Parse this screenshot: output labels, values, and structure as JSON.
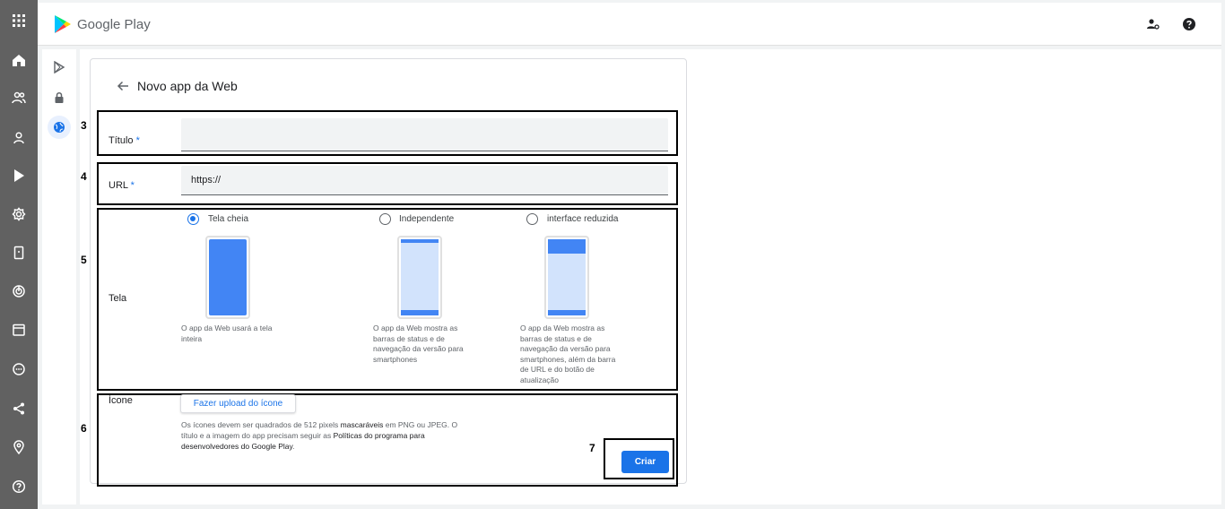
{
  "app": {
    "logo_text": "Google Play"
  },
  "left_nav": {
    "icons": [
      "apps-grid-icon",
      "home-icon",
      "users-icon",
      "user-icon",
      "play-icon",
      "settings-icon",
      "device-icon",
      "data-usage-icon",
      "calendar-icon",
      "chat-icon",
      "share-icon",
      "location-icon",
      "help-icon"
    ]
  },
  "sub_nav": {
    "icons": [
      "play-store-icon",
      "lock-icon",
      "web-globe-icon"
    ],
    "active": "web-globe-icon"
  },
  "header": {
    "title": "Novo app da Web"
  },
  "annotations": {
    "n3": "3",
    "n4": "4",
    "n5": "5",
    "n6": "6",
    "n7": "7"
  },
  "form": {
    "title_label": "Título",
    "url_label": "URL",
    "required_mark": "*",
    "title_value": "",
    "url_value": "https://",
    "display_label": "Tela",
    "display_options": [
      {
        "label": "Tela cheia",
        "checked": true,
        "description": "O app da Web usará a tela inteira"
      },
      {
        "label": "Independente",
        "checked": false,
        "description": "O app da Web mostra as barras de status e de navegação da versão para smartphones"
      },
      {
        "label": "interface reduzida",
        "checked": false,
        "description": "O app da Web mostra as barras de status e de navegação da versão para smartphones, além da barra de URL e do botão de atualização"
      }
    ],
    "icon_label": "Ícone",
    "upload_button": "Fazer upload do ícone",
    "icon_desc_1": "Os ícones devem ser quadrados de 512 pixels ",
    "icon_desc_2": "mascaráveis",
    "icon_desc_3": " em PNG ou JPEG. O título e a imagem do app precisam seguir as ",
    "icon_desc_4": "Políticas do programa para desenvolvedores do Google Play",
    "icon_desc_5": ".",
    "create_button": "Criar"
  },
  "colors": {
    "accent": "#1a73e8",
    "phone_fill": "#4285f4",
    "phone_light": "#d2e3fc",
    "sidebar": "#616161"
  }
}
